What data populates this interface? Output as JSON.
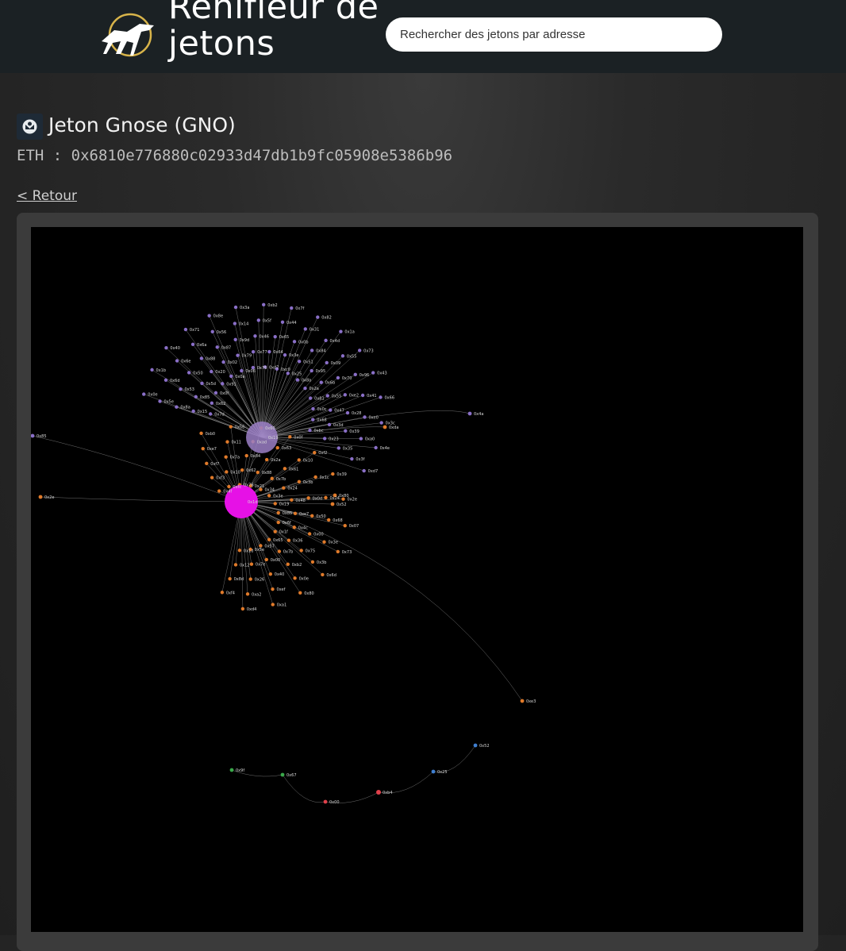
{
  "header": {
    "brand": "Renifleur de jetons",
    "search_placeholder": "Rechercher des jetons par adresse"
  },
  "token": {
    "title": "Jeton Gnose (GNO)",
    "address_line": "ETH : 0x6810e776880c02933d47db1b9fc05908e5386b96"
  },
  "nav": {
    "back_label": "< Retour"
  },
  "graph": {
    "colors": {
      "canvas": "#000000",
      "edge": "#b8b8b8",
      "hub_purple": "#9b7fc6",
      "hub_magenta": "#e611e6",
      "node_purple": "#8a6fc8",
      "node_orange": "#e07a2a",
      "node_blue": "#3f7fd0",
      "node_green": "#3aa84a",
      "node_red": "#e0404a"
    },
    "hubs": [
      {
        "id": "purple",
        "label": "0x19",
        "color": "#9b7fc6"
      },
      {
        "id": "magenta",
        "label": "0x1d",
        "color": "#e611e6"
      }
    ],
    "purple_cluster_labels": [
      "0x7d",
      "0x15",
      "0x8a",
      "0x5e",
      "0x0e",
      "0x62",
      "0x85",
      "0x53",
      "0x6d",
      "0x1b",
      "0x0f",
      "0x5d",
      "0x50",
      "0x6e",
      "0x40",
      "0x91",
      "0x20",
      "0x88",
      "0x6a",
      "0x71",
      "0x0a",
      "0x02",
      "0x87",
      "0x56",
      "0x8e",
      "0x06",
      "0x79",
      "0x9d",
      "0x14",
      "0x3a",
      "0x76",
      "0x77",
      "0x46",
      "0x5f",
      "0xb2",
      "0xd7",
      "0x64",
      "0x65",
      "0x44",
      "0x7f",
      "0xc0",
      "0x3e",
      "0x0b",
      "0x31",
      "0x82",
      "0x25",
      "0x51",
      "0x84",
      "0x4d",
      "0x1a",
      "0x8a",
      "0x95",
      "0x09",
      "0x55",
      "0x73",
      "0x2a",
      "0x6b",
      "0x70",
      "0x96",
      "0x43",
      "0x81",
      "0x55",
      "0xe2",
      "0x41",
      "0x66",
      "0x0c",
      "0x47",
      "0x28",
      "0xe0",
      "0x3c",
      "0x68",
      "0x3d",
      "0x39",
      "0xa0",
      "0x4e",
      "0xbc",
      "0x23",
      "0x35",
      "0x3f",
      "0xd7"
    ],
    "orange_cluster_labels": [
      "0x4f",
      "0xf3",
      "0xf7",
      "0xe7",
      "0xb0",
      "0xfc",
      "0x10",
      "0x7a",
      "0x11",
      "0x56",
      "0x76",
      "0x62",
      "0x84",
      "0xad",
      "0x60",
      "0x21",
      "0x88",
      "0x2a",
      "0x63",
      "0x0f",
      "0x34",
      "0x7b",
      "0x61",
      "0x10",
      "0xf2",
      "0x3e",
      "0x24",
      "0x3b",
      "0x1c",
      "0x39",
      "0x19",
      "0x48",
      "0x0d",
      "0x24",
      "0x2e",
      "0x85",
      "0xe7",
      "0x50",
      "0x68",
      "0x07",
      "0x6f",
      "0x4c",
      "0x00",
      "0x3e",
      "0x73",
      "0x1f",
      "0x36",
      "0x75",
      "0x3b",
      "0x6d",
      "0x65",
      "0x7b",
      "0xb2",
      "0x0e",
      "0x80",
      "0x57",
      "0x00",
      "0x40",
      "0xef",
      "0xa1",
      "0x5e",
      "0x7e",
      "0x26",
      "0xa2",
      "0xd4",
      "0x1d",
      "0x12",
      "0x8d",
      "0xf4"
    ],
    "outliers": [
      {
        "label": "0x85",
        "color": "#8a6fc8"
      },
      {
        "label": "0x2e",
        "color": "#e07a2a"
      },
      {
        "label": "0x4a",
        "color": "#8a6fc8"
      },
      {
        "label": "0xda",
        "color": "#e07a2a"
      },
      {
        "label": "0x80",
        "color": "#e07a2a"
      },
      {
        "label": "0x52",
        "color": "#e07a2a"
      },
      {
        "label": "0xe3",
        "color": "#e07a2a"
      }
    ],
    "chain": [
      {
        "label": "0x9f",
        "color": "#3aa84a"
      },
      {
        "label": "0x67",
        "color": "#3aa84a"
      },
      {
        "label": "0x00",
        "color": "#e0404a"
      },
      {
        "label": "0xb4",
        "color": "#e0404a"
      },
      {
        "label": "0x25",
        "color": "#3f7fd0"
      },
      {
        "label": "0x52",
        "color": "#3f7fd0"
      }
    ]
  }
}
